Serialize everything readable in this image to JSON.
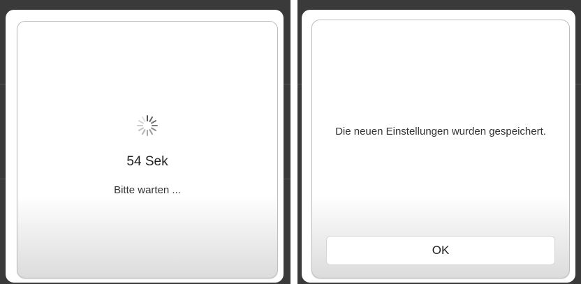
{
  "progress_dialog": {
    "timer": "54 Sek",
    "message": "Bitte warten ..."
  },
  "confirm_dialog": {
    "message": "Die neuen Einstellungen wurden gespeichert.",
    "ok_label": "OK"
  },
  "colors": {
    "backdrop": "#3a3a3a",
    "dialog_bg": "#ffffff",
    "dialog_border": "#bdbdbd",
    "text": "#222222"
  },
  "icons": {
    "spinner": "loading-spinner-icon"
  }
}
